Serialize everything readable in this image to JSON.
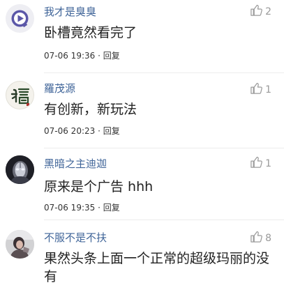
{
  "comments": [
    {
      "username": "我才是臭臭",
      "like_count": "2",
      "content": "卧槽竟然看完了",
      "time": "07-06 19:36",
      "reply_label": "回复",
      "avatar": "play-logo-avatar"
    },
    {
      "username": "羅茂源",
      "like_count": "1",
      "content": "有创新，新玩法",
      "time": "07-06 20:23",
      "reply_label": "回复",
      "avatar": "calligraphy-avatar"
    },
    {
      "username": "黑暗之主迪迦",
      "like_count": "1",
      "content": "原来是个广告 hhh",
      "time": "07-06 19:35",
      "reply_label": "回复",
      "avatar": "hero-avatar"
    },
    {
      "username": "不服不是不扶",
      "like_count": "8",
      "content": "果然头条上面一个正常的超级玛丽的没有",
      "time": "",
      "reply_label": "",
      "avatar": "photo-avatar"
    }
  ],
  "colors": {
    "username": "#406599",
    "meta": "#333333",
    "like": "#999999"
  }
}
